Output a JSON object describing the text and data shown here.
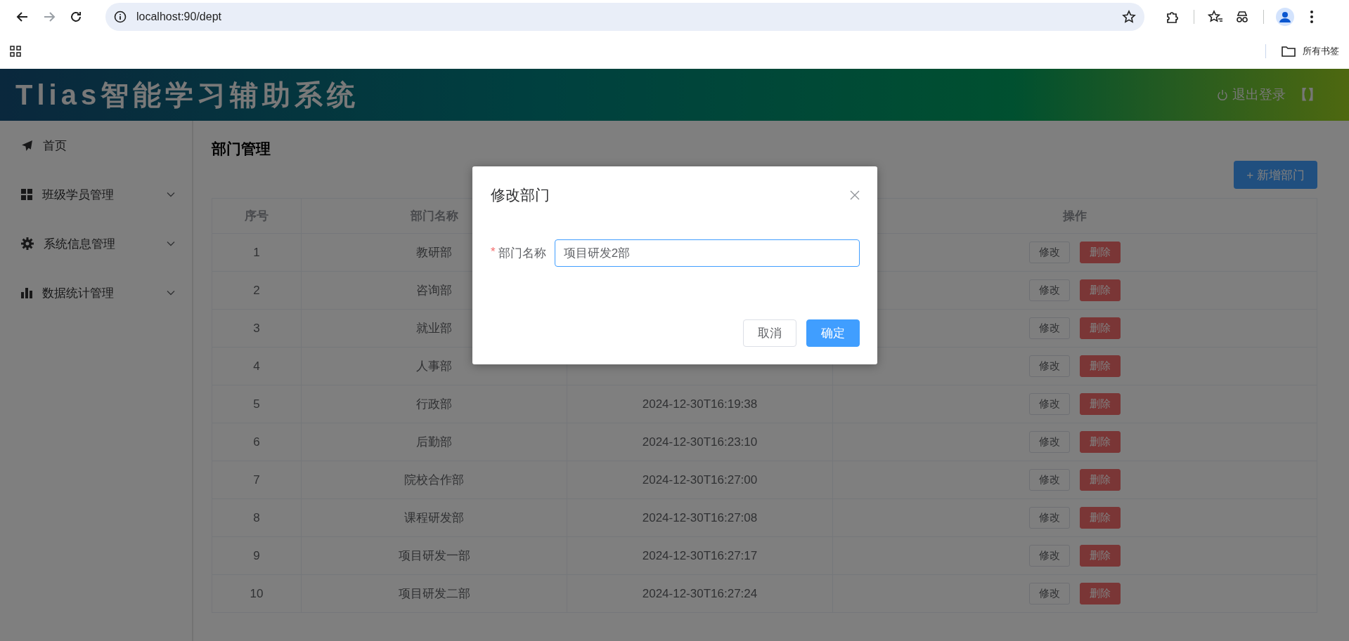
{
  "browser": {
    "url": "localhost:90/dept",
    "back_disabled": false,
    "forward_disabled": true,
    "bookmarks_label": "所有书签"
  },
  "header": {
    "title": "Tlias智能学习辅助系统",
    "logout": "退出登录",
    "logout_suffix": "【】"
  },
  "sidebar": {
    "items": [
      {
        "label": "首页",
        "kind": "link"
      },
      {
        "label": "班级学员管理",
        "kind": "submenu",
        "expanded": false
      },
      {
        "label": "系统信息管理",
        "kind": "submenu",
        "expanded": false
      },
      {
        "label": "数据统计管理",
        "kind": "submenu",
        "expanded": false
      }
    ]
  },
  "page": {
    "title": "部门管理",
    "add_button": "+ 新增部门"
  },
  "table": {
    "columns": [
      "序号",
      "部门名称",
      null,
      "操作"
    ],
    "rows": [
      {
        "index": "1",
        "name": "教研部",
        "actions": [
          {
            "label": "修改",
            "kind": "default"
          },
          {
            "label": "删除",
            "kind": "danger"
          }
        ]
      },
      {
        "index": "2",
        "name": "咨询部",
        "actions": [
          {
            "label": "修改",
            "kind": "default"
          },
          {
            "label": "删除",
            "kind": "danger"
          }
        ]
      },
      {
        "index": "3",
        "name": "就业部",
        "actions": [
          {
            "label": "修改",
            "kind": "default"
          },
          {
            "label": "删除",
            "kind": "danger"
          }
        ]
      },
      {
        "index": "4",
        "name": "人事部",
        "actions": [
          {
            "label": "修改",
            "kind": "default"
          },
          {
            "label": "删除",
            "kind": "danger"
          }
        ]
      },
      {
        "index": "5",
        "name": "行政部",
        "column_3": "2024-12-30T16:19:38",
        "actions": [
          {
            "label": "修改",
            "kind": "default"
          },
          {
            "label": "删除",
            "kind": "danger"
          }
        ]
      },
      {
        "index": "6",
        "name": "后勤部",
        "column_3": "2024-12-30T16:23:10",
        "actions": [
          {
            "label": "修改",
            "kind": "default"
          },
          {
            "label": "删除",
            "kind": "danger"
          }
        ]
      },
      {
        "index": "7",
        "name": "院校合作部",
        "column_3": "2024-12-30T16:27:00",
        "actions": [
          {
            "label": "修改",
            "kind": "default"
          },
          {
            "label": "删除",
            "kind": "danger"
          }
        ]
      },
      {
        "index": "8",
        "name": "课程研发部",
        "column_3": "2024-12-30T16:27:08",
        "actions": [
          {
            "label": "修改",
            "kind": "default"
          },
          {
            "label": "删除",
            "kind": "danger"
          }
        ]
      },
      {
        "index": "9",
        "name": "项目研发一部",
        "column_3": "2024-12-30T16:27:17",
        "actions": [
          {
            "label": "修改",
            "kind": "default"
          },
          {
            "label": "删除",
            "kind": "danger"
          }
        ]
      },
      {
        "index": "10",
        "name": "项目研发二部",
        "column_3": "2024-12-30T16:27:24",
        "actions": [
          {
            "label": "修改",
            "kind": "default"
          },
          {
            "label": "删除",
            "kind": "danger"
          }
        ]
      }
    ]
  },
  "dialog": {
    "title": "修改部门",
    "required_mark": "*",
    "field_label": "部门名称",
    "field_value": "项目研发2部",
    "focused": true,
    "buttons": [
      {
        "label": "取消",
        "kind": "default"
      },
      {
        "label": "确定",
        "kind": "primary"
      }
    ]
  }
}
